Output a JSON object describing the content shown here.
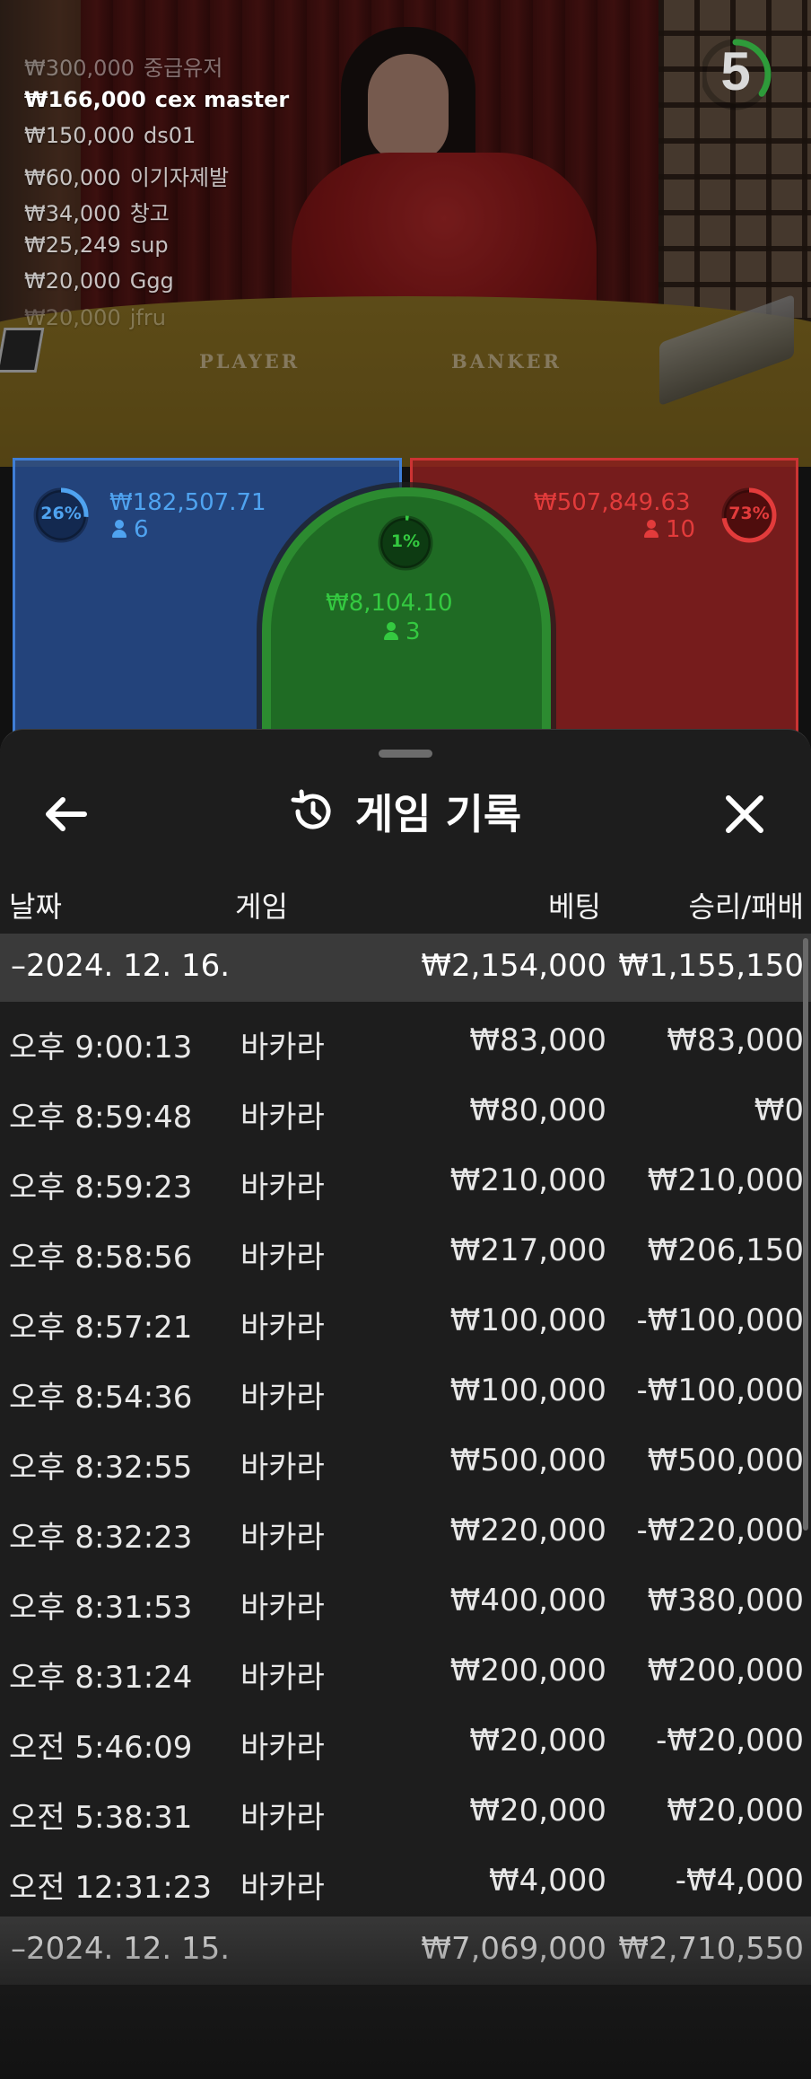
{
  "leaderboard": [
    {
      "amount": "₩300,000",
      "name": "중급유저"
    },
    {
      "amount": "₩166,000",
      "name": "cex master"
    },
    {
      "amount": "₩150,000",
      "name": "ds01"
    },
    {
      "amount": "₩60,000",
      "name": "이기자제발"
    },
    {
      "amount": "₩34,000",
      "name": "창고"
    },
    {
      "amount": "₩25,249",
      "name": "sup"
    },
    {
      "amount": "₩20,000",
      "name": "Ggg"
    },
    {
      "amount": "₩20,000",
      "name": "jfru"
    }
  ],
  "timer": {
    "seconds": "5",
    "progress": 0.35
  },
  "table_labels": {
    "player": "PLAYER",
    "banker": "BANKER"
  },
  "bets": {
    "player": {
      "percent": "26%",
      "percent_value": 0.26,
      "amount": "₩182,507.71",
      "players": "6"
    },
    "tie": {
      "percent": "1%",
      "percent_value": 0.01,
      "amount": "₩8,104.10",
      "players": "3"
    },
    "banker": {
      "percent": "73%",
      "percent_value": 0.73,
      "amount": "₩507,849.63",
      "players": "10"
    }
  },
  "colors": {
    "player": "#4fa3f0",
    "tie": "#34c940",
    "banker": "#e23b3b"
  },
  "sheet": {
    "title": "게임 기록",
    "back_icon": "arrow-left-icon",
    "history_icon": "history-icon",
    "close_icon": "close-icon",
    "columns": {
      "date": "날짜",
      "game": "게임",
      "bet": "베팅",
      "result": "승리/패배"
    },
    "groups": [
      {
        "date": "2024. 12. 16.",
        "bet_total": "₩2,154,000",
        "result_total": "₩1,155,150",
        "rows": [
          {
            "time": "오후 9:00:13",
            "game": "바카라",
            "bet": "₩83,000",
            "result": "₩83,000"
          },
          {
            "time": "오후 8:59:48",
            "game": "바카라",
            "bet": "₩80,000",
            "result": "₩0"
          },
          {
            "time": "오후 8:59:23",
            "game": "바카라",
            "bet": "₩210,000",
            "result": "₩210,000"
          },
          {
            "time": "오후 8:58:56",
            "game": "바카라",
            "bet": "₩217,000",
            "result": "₩206,150"
          },
          {
            "time": "오후 8:57:21",
            "game": "바카라",
            "bet": "₩100,000",
            "result": "-₩100,000"
          },
          {
            "time": "오후 8:54:36",
            "game": "바카라",
            "bet": "₩100,000",
            "result": "-₩100,000"
          },
          {
            "time": "오후 8:32:55",
            "game": "바카라",
            "bet": "₩500,000",
            "result": "₩500,000"
          },
          {
            "time": "오후 8:32:23",
            "game": "바카라",
            "bet": "₩220,000",
            "result": "-₩220,000"
          },
          {
            "time": "오후 8:31:53",
            "game": "바카라",
            "bet": "₩400,000",
            "result": "₩380,000"
          },
          {
            "time": "오후 8:31:24",
            "game": "바카라",
            "bet": "₩200,000",
            "result": "₩200,000"
          },
          {
            "time": "오전 5:46:09",
            "game": "바카라",
            "bet": "₩20,000",
            "result": "-₩20,000"
          },
          {
            "time": "오전 5:38:31",
            "game": "바카라",
            "bet": "₩20,000",
            "result": "₩20,000"
          },
          {
            "time": "오전 12:31:23",
            "game": "바카라",
            "bet": "₩4,000",
            "result": "-₩4,000"
          }
        ]
      },
      {
        "date": "2024. 12. 15.",
        "bet_total": "₩7,069,000",
        "result_total": "₩2,710,550",
        "rows": []
      }
    ]
  }
}
